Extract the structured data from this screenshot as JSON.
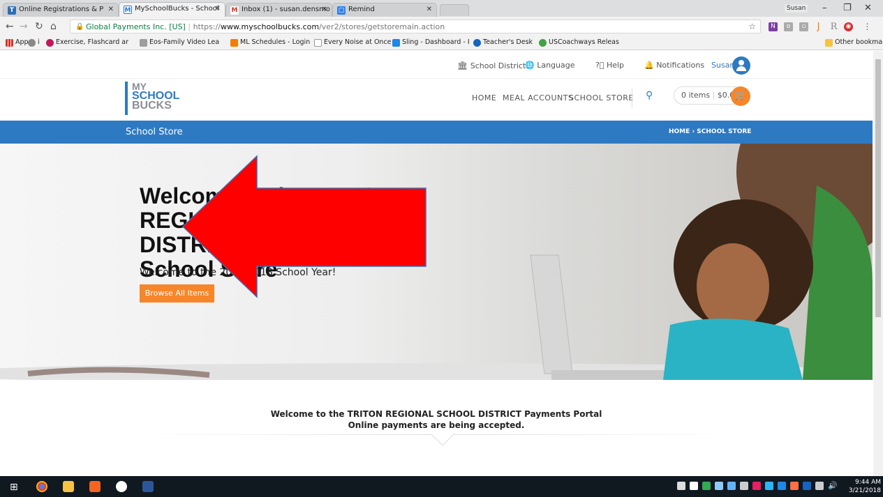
{
  "browser": {
    "tabs": [
      {
        "title": "Online Registrations & P",
        "fav_color": "#2f6db5"
      },
      {
        "title": "MySchoolBucks - School",
        "fav_color": "#2e7ac2"
      },
      {
        "title": "Inbox (1) - susan.densmo",
        "fav_color": "#d93025"
      },
      {
        "title": "Remind",
        "fav_color": "#2f80ed"
      }
    ],
    "active_tab_index": 1,
    "profile_name": "Susan",
    "window_controls": {
      "minimize": "–",
      "maximize": "❐",
      "close": "✕"
    },
    "security_label": "Global Payments Inc. [US]",
    "url_prefix": "https://",
    "url_host": "www.myschoolbucks.com",
    "url_path": "/ver2/stores/getstoremain.action",
    "bookmarks": [
      {
        "label": "Apps",
        "color": "#d93025"
      },
      {
        "label": "i",
        "color": "#888"
      },
      {
        "label": "Exercise, Flashcard ar",
        "color": "#c2185b"
      },
      {
        "label": "Eos-Family Video Lea",
        "color": "#9e9e9e"
      },
      {
        "label": "ML Schedules - Login",
        "color": "#f57c00"
      },
      {
        "label": "Every Noise at Once",
        "color": "#bbbbbb"
      },
      {
        "label": "Sling - Dashboard - I",
        "color": "#1e88e5"
      },
      {
        "label": "Teacher's Desk",
        "color": "#1565c0"
      },
      {
        "label": "USCoachways Releas",
        "color": "#43a047"
      }
    ],
    "other_bookmarks": "Other bookmarks"
  },
  "site": {
    "util_nav": {
      "school_district": "School District",
      "language": "Language",
      "help": "Help",
      "notifications": "Notifications",
      "user": "Susan"
    },
    "logo": {
      "line1": "MY",
      "line2": "SCHOOL",
      "line3": "BUCKS"
    },
    "main_nav": {
      "home": "HOME",
      "meal_accounts": "MEAL ACCOUNTS",
      "school_store": "SCHOOL STORE"
    },
    "cart": {
      "items": "0 items",
      "total": "$0.00"
    },
    "page_title": "School Store",
    "breadcrumb": {
      "home": "HOME",
      "separator": "›",
      "current": "SCHOOL STORE"
    },
    "hero": {
      "heading_line1": "Welcome to the TRITON",
      "heading_line2": "REGIONAL SCHOOL DISTRICT",
      "heading_line3": "School Store",
      "subtitle": "Welcome to the 2017-2018 School Year!",
      "button": "Browse All Items"
    },
    "welcome_line1": "Welcome to the TRITON REGIONAL SCHOOL DISTRICT Payments Portal",
    "welcome_line2": "Online payments are being accepted."
  },
  "taskbar": {
    "time": "9:44 AM",
    "date": "3/21/2018"
  },
  "colors": {
    "brand_blue": "#2e7ac2",
    "accent_orange": "#f7862a",
    "annotation_arrow": "#ff0000"
  }
}
